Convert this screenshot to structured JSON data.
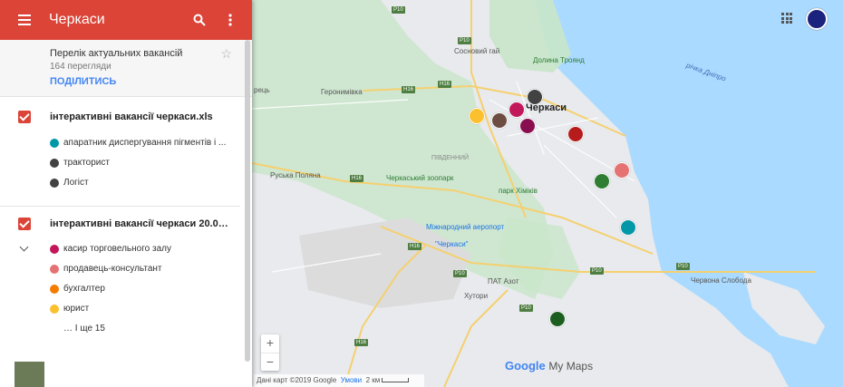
{
  "header": {
    "title": "Черкаси"
  },
  "info": {
    "description": "Перелік актуальних вакансій",
    "views": "164 перегляди",
    "share": "ПОДІЛИТИСЬ"
  },
  "layers": [
    {
      "name": "інтерактивні вакансії черкаси.xls",
      "items": [
        {
          "label": "апаратник диспергування пігментів і ...",
          "color": "#0097a7"
        },
        {
          "label": "тракторист",
          "color": "#424242"
        },
        {
          "label": "Логіст",
          "color": "#424242"
        }
      ]
    },
    {
      "name": "інтерактивні вакансії черкаси 20.05...",
      "items": [
        {
          "label": "касир торговельного залу",
          "color": "#c2185b"
        },
        {
          "label": "продавець-консультант",
          "color": "#e57373"
        },
        {
          "label": "бухгалтер",
          "color": "#f57c00"
        },
        {
          "label": "юрист",
          "color": "#fbc02d"
        }
      ],
      "more": "… І ще 15"
    }
  ],
  "map": {
    "places": [
      "Сосновий гай",
      "Долина Троянд",
      "Черкаси",
      "Геронимівка",
      "Руська Поляна",
      "ПІВДЕННИЙ",
      "Черкаський зоопарк",
      "парк Хіміків",
      "Міжнародний аеропорт",
      "\"Черкаси\"",
      "ПАТ Азот",
      "Хутори",
      "Червона Слобода",
      "річка Дніпро",
      "рець"
    ],
    "roads": [
      "P10",
      "P10",
      "H16",
      "H16",
      "H16",
      "H16",
      "P10",
      "P10",
      "P10",
      "H16",
      "P10"
    ],
    "attribution": "Дані карт ©2019 Google",
    "terms": "Умови",
    "scale": "2 км",
    "logo_google": "Google",
    "logo_mymaps": "My Maps"
  },
  "zoom": {
    "in": "+",
    "out": "−"
  },
  "colors": {
    "header": "#db4437",
    "water": "#aadaff",
    "land": "#e8eaed",
    "park": "#c8e6c9"
  }
}
